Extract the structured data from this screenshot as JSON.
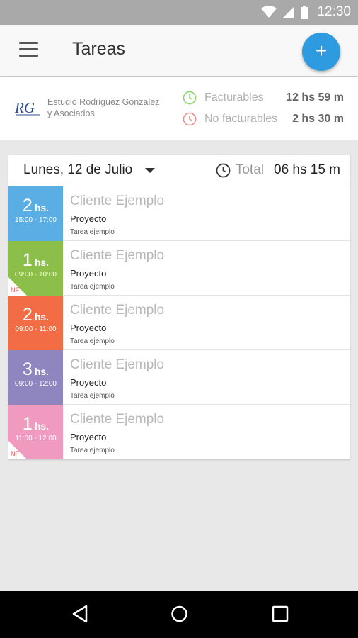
{
  "status_bar": {
    "time": "12:30"
  },
  "app_bar": {
    "title": "Tareas",
    "add_label": "+"
  },
  "company": {
    "logo_text": "RG",
    "name": "Estudio Rodriguez Gonzalez y Asociados",
    "billable_label": "Facturables",
    "billable_value": "12 hs 59 m",
    "non_billable_label": "No facturables",
    "non_billable_value": "2 hs 30 m"
  },
  "day": {
    "date_label": "Lunes, 12 de Julio",
    "total_label": "Total",
    "total_value": "06 hs  15 m"
  },
  "tasks": [
    {
      "hours": "2",
      "unit": "hs.",
      "range": "15:00 - 17:00",
      "client": "Cliente Ejemplo",
      "project": "Proyecto",
      "task": "Tarea ejemplo",
      "color": "#5aaee3",
      "nf": false
    },
    {
      "hours": "1",
      "unit": "hs.",
      "range": "09:00 - 10:00",
      "client": "Cliente Ejemplo",
      "project": "Proyecto",
      "task": "Tarea ejemplo",
      "color": "#8cbf4a",
      "nf": true,
      "nf_label": "NF"
    },
    {
      "hours": "2",
      "unit": "hs.",
      "range": "09:00 - 11:00",
      "client": "Cliente Ejemplo",
      "project": "Proyecto",
      "task": "Tarea ejemplo",
      "color": "#f26d46",
      "nf": false
    },
    {
      "hours": "3",
      "unit": "hs.",
      "range": "09:00 - 12:00",
      "client": "Cliente Ejemplo",
      "project": "Proyecto",
      "task": "Tarea ejemplo",
      "color": "#8f86bf",
      "nf": false
    },
    {
      "hours": "1",
      "unit": "hs.",
      "range": "11:00 - 12:00",
      "client": "Cliente Ejemplo",
      "project": "Proyecto",
      "task": "Tarea ejemplo",
      "color": "#f09abf",
      "nf": true,
      "nf_label": "NF"
    }
  ],
  "colors": {
    "accent": "#2e9ae0",
    "billable": "#8cd66a",
    "non_billable": "#ef8a8a"
  },
  "icons": {
    "menu": "hamburger-icon",
    "add": "plus-icon",
    "clock": "clock-icon",
    "back": "back-triangle-icon",
    "home": "home-circle-icon",
    "recents": "recents-square-icon"
  }
}
